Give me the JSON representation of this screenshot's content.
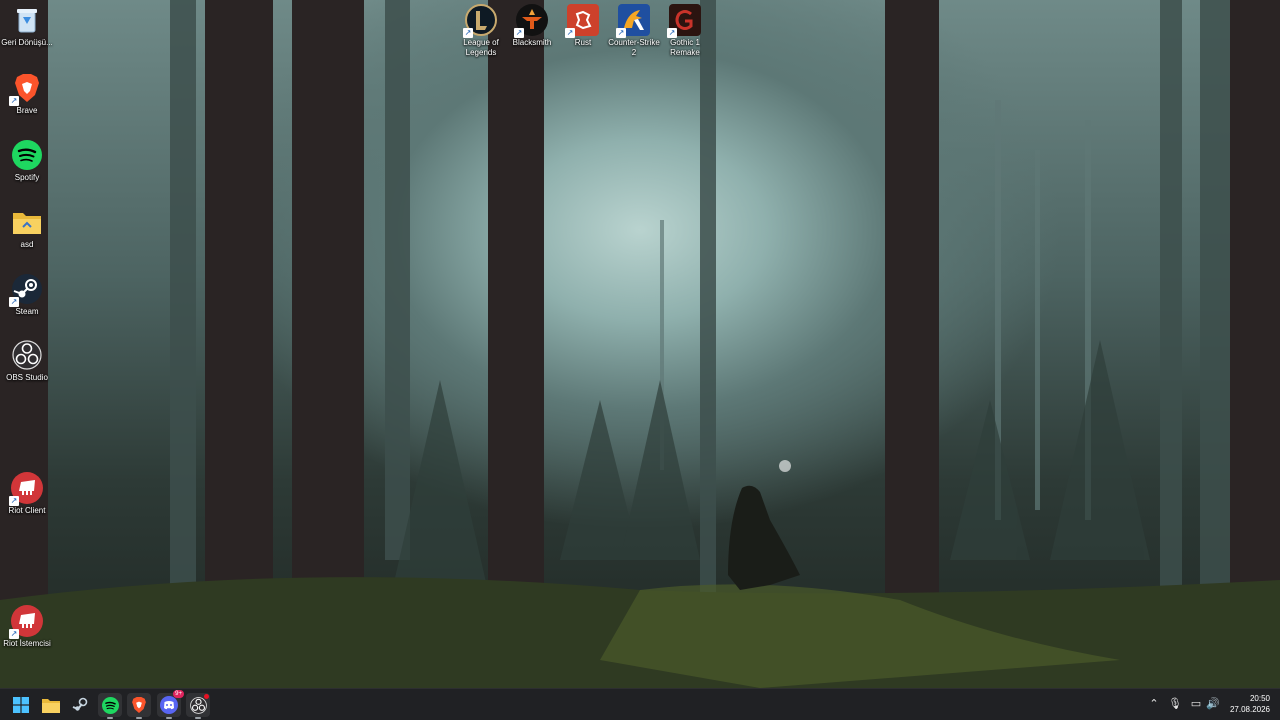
{
  "desktop": {
    "left_icons": [
      {
        "label": "Geri Dönüşü...",
        "icon": "recycle-bin-icon",
        "shortcut": false
      },
      {
        "label": "Brave",
        "icon": "brave-icon",
        "shortcut": true
      },
      {
        "label": "Spotify",
        "icon": "spotify-icon",
        "shortcut": false
      },
      {
        "label": "asd",
        "icon": "folder-icon",
        "shortcut": false
      },
      {
        "label": "Steam",
        "icon": "steam-icon",
        "shortcut": true
      },
      {
        "label": "OBS Studio",
        "icon": "obs-icon",
        "shortcut": false
      },
      {
        "label": "Riot Client",
        "icon": "riot-client-icon",
        "shortcut": true
      },
      {
        "label": "Riot İstemcisi",
        "icon": "riot-client-icon",
        "shortcut": true
      }
    ],
    "top_icons": [
      {
        "label": "League of Legends",
        "icon": "league-of-legends-icon",
        "shortcut": true
      },
      {
        "label": "Blacksmith",
        "icon": "blacksmith-icon",
        "shortcut": true
      },
      {
        "label": "Rust",
        "icon": "rust-icon",
        "shortcut": true
      },
      {
        "label": "Counter-Strike 2",
        "icon": "counter-strike-icon",
        "shortcut": true
      },
      {
        "label": "Gothic 1 Remake",
        "icon": "gothic-icon",
        "shortcut": true
      }
    ]
  },
  "taskbar": {
    "apps": [
      {
        "name": "start",
        "icon": "windows-start-icon"
      },
      {
        "name": "file-explorer",
        "icon": "file-explorer-icon"
      },
      {
        "name": "steam",
        "icon": "steam-icon"
      },
      {
        "name": "spotify",
        "icon": "spotify-icon"
      },
      {
        "name": "brave",
        "icon": "brave-icon"
      },
      {
        "name": "discord",
        "icon": "discord-icon",
        "badge": "9+"
      },
      {
        "name": "obs",
        "icon": "obs-icon"
      }
    ],
    "clock": {
      "time": "20:50",
      "date": "27.08.2026"
    }
  },
  "colors": {
    "taskbar_bg": "#202124",
    "brave": "#fb542b",
    "spotify": "#1ed760",
    "riot": "#d13639",
    "rust": "#cd412b",
    "discord": "#5865f2"
  }
}
